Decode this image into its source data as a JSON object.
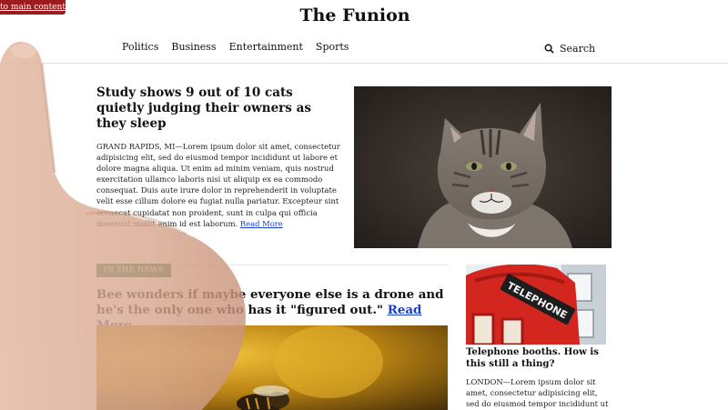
{
  "skip_link": "to main content",
  "site": {
    "title": "The Funion"
  },
  "nav": {
    "items": [
      "Politics",
      "Business",
      "Entertainment",
      "Sports"
    ],
    "search_label": "Search"
  },
  "lead_story": {
    "headline": "Study shows 9 out of 10 cats quietly judging their owners as they sleep",
    "body": "GRAND RAPIDS, MI—Lorem ipsum dolor sit amet, consectetur adipisicing elit, sed do eiusmod tempor incididunt ut labore et dolore magna aliqua. Ut enim ad minim veniam, quis nostrud exercitation ullamco laboris nisi ut aliquip ex ea commodo consequat. Duis aute irure dolor in reprehenderit in voluptate velit esse cillum dolore eu fugiat nulla pariatur. Excepteur sint occaecat cupidatat non proident, sunt in culpa qui officia deserunt mollit anim id est laborum.",
    "read_more": "Read More"
  },
  "in_the_news": {
    "tag": "IN THE NEWS",
    "headline": "Bee wonders if maybe everyone else is a drone and he's the only one who has it \"figured out.\"",
    "read_more": "Read More"
  },
  "side_story": {
    "sign_text": "TELEPHONE",
    "headline": "Telephone booths. How is this still a thing?",
    "body": "LONDON—Lorem ipsum dolor sit amet, consectetur adipisicing elit, sed do eiusmod tempor incididunt ut"
  },
  "colors": {
    "skip_link_bg": "#9b1b1f",
    "tag_bg": "#1e6b3a",
    "link": "#1a3fc7",
    "booth_red": "#d2261f"
  }
}
